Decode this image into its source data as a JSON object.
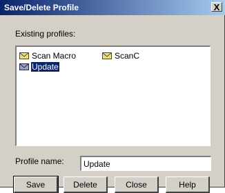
{
  "window": {
    "title": "Save/Delete Profile",
    "close_glyph": "X"
  },
  "profiles": {
    "label": "Existing profiles:",
    "items": [
      {
        "label": "Scan Macro",
        "icon": "envelope-icon",
        "selected": false
      },
      {
        "label": "ScanC",
        "icon": "envelope-icon",
        "selected": false
      },
      {
        "label": "Update",
        "icon": "envelope-icon",
        "selected": true
      }
    ]
  },
  "profile_name": {
    "label": "Profile name:",
    "value": "Update"
  },
  "buttons": {
    "save": "Save",
    "delete": "Delete",
    "close": "Close",
    "help": "Help"
  },
  "colors": {
    "titlebar_start": "#0a246a",
    "titlebar_end": "#a6caf0",
    "face": "#d4d0c8",
    "selection": "#0a246a",
    "icon_yellow": "#f0e070"
  }
}
